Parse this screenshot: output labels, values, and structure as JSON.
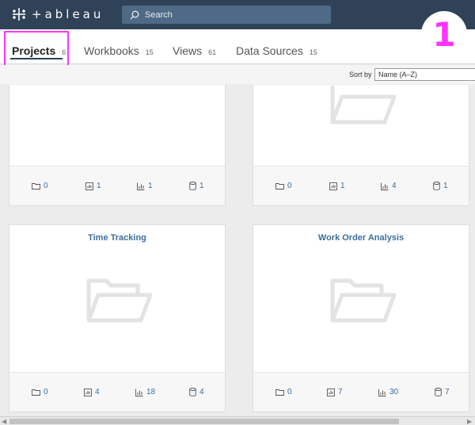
{
  "app": {
    "logo_text": "+ableau"
  },
  "search": {
    "placeholder": "Search"
  },
  "tabs": [
    {
      "label": "Projects",
      "count": "6"
    },
    {
      "label": "Workbooks",
      "count": "15"
    },
    {
      "label": "Views",
      "count": "61"
    },
    {
      "label": "Data Sources",
      "count": "15"
    }
  ],
  "annotation": {
    "step": "1"
  },
  "sort": {
    "label": "Sort by",
    "value": "Name (A–Z)"
  },
  "cards": [
    {
      "title": "",
      "stats": {
        "projects": "0",
        "workbooks": "1",
        "views": "1",
        "datasources": "1"
      }
    },
    {
      "title": "",
      "stats": {
        "projects": "0",
        "workbooks": "1",
        "views": "4",
        "datasources": "1"
      }
    },
    {
      "title": "Time Tracking",
      "stats": {
        "projects": "0",
        "workbooks": "4",
        "views": "18",
        "datasources": "4"
      }
    },
    {
      "title": "Work Order Analysis",
      "stats": {
        "projects": "0",
        "workbooks": "7",
        "views": "30",
        "datasources": "7"
      }
    }
  ],
  "colors": {
    "topbar": "#2f4257",
    "accent": "#3c6e9e",
    "highlight": "#ff33ff"
  }
}
